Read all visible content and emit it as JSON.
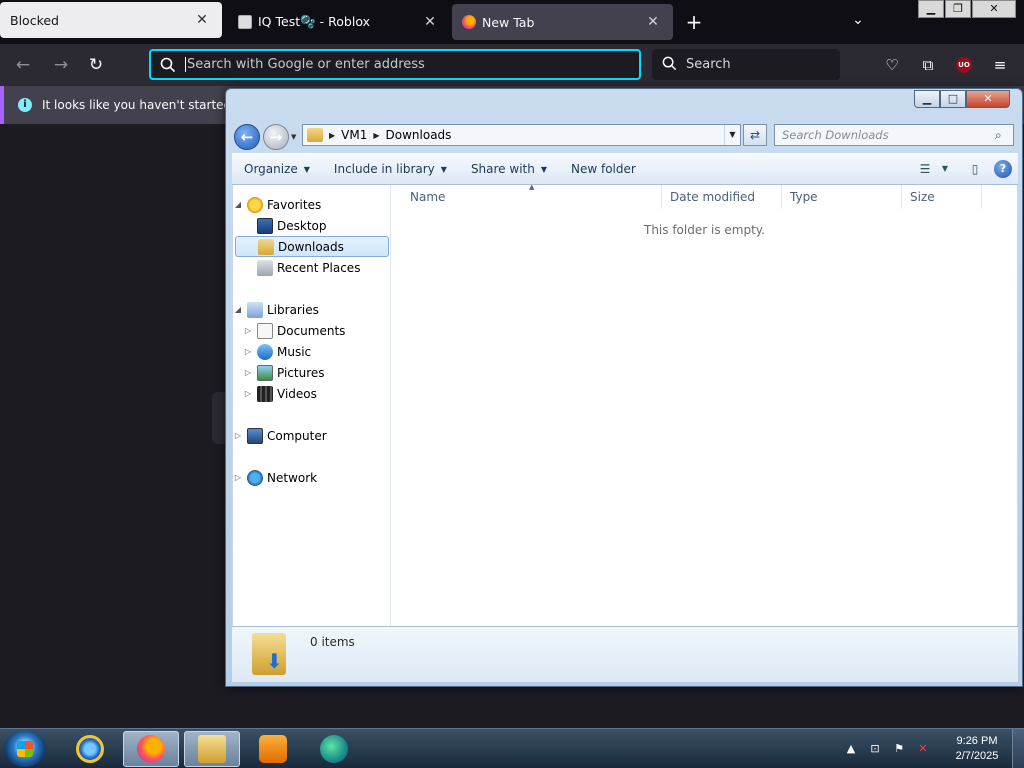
{
  "browser": {
    "tabs": [
      {
        "title": "Blocked"
      },
      {
        "title": "IQ Test🫧 - Roblox"
      },
      {
        "title": "New Tab"
      }
    ],
    "url_placeholder": "Search with Google or enter address",
    "search_placeholder": "Search",
    "ublock_badge": "UO",
    "notification": "It looks like you haven't started Fir"
  },
  "explorer": {
    "breadcrumbs": [
      "VM1",
      "Downloads"
    ],
    "search_placeholder": "Search Downloads",
    "toolbar": {
      "organize": "Organize",
      "include_in_library": "Include in library",
      "share_with": "Share with",
      "new_folder": "New folder"
    },
    "nav": {
      "favorites": "Favorites",
      "desktop": "Desktop",
      "downloads": "Downloads",
      "recent_places": "Recent Places",
      "libraries": "Libraries",
      "documents": "Documents",
      "music": "Music",
      "pictures": "Pictures",
      "videos": "Videos",
      "computer": "Computer",
      "network": "Network"
    },
    "columns": [
      "Name",
      "Date modified",
      "Type",
      "Size"
    ],
    "empty_message": "This folder is empty.",
    "details": {
      "item_count": "0 items"
    }
  },
  "taskbar": {
    "time": "9:26 PM",
    "date": "2/7/2025"
  },
  "colors": {
    "firefox_focus_ring": "#00ddff",
    "notification_accent": "#a862ff",
    "explorer_selection": "#cfe5fb"
  }
}
